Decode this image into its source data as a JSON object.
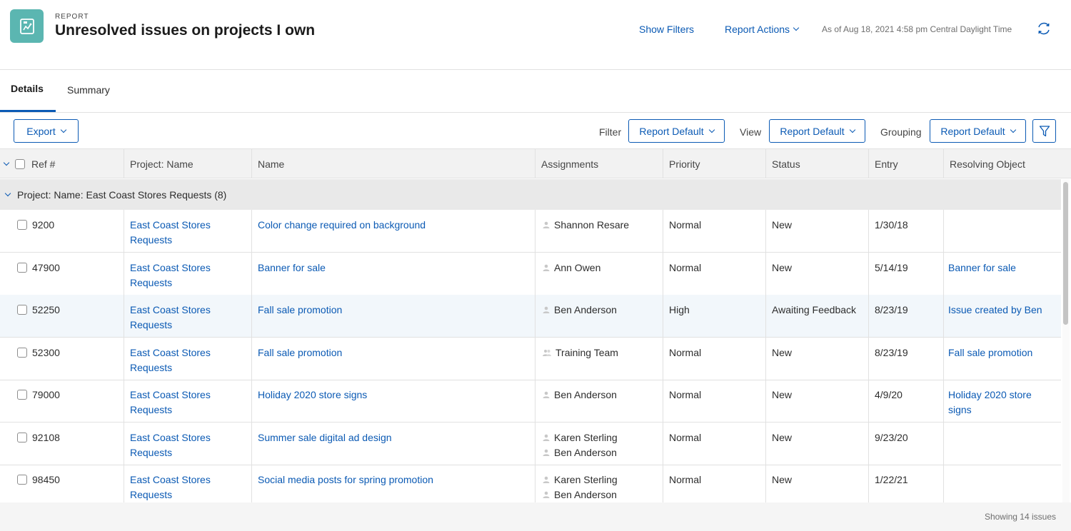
{
  "header": {
    "kicker": "REPORT",
    "title": "Unresolved issues on projects I own",
    "show_filters": "Show Filters",
    "report_actions": "Report Actions",
    "as_of": "As of Aug 18, 2021 4:58 pm Central Daylight Time",
    "icon": "report-chart-icon",
    "accent_color": "#5bb6b1"
  },
  "tabs": [
    {
      "label": "Details",
      "active": true
    },
    {
      "label": "Summary",
      "active": false
    }
  ],
  "toolbar": {
    "export_label": "Export",
    "filter_label": "Filter",
    "filter_value": "Report Default",
    "view_label": "View",
    "view_value": "Report Default",
    "grouping_label": "Grouping",
    "grouping_value": "Report Default"
  },
  "columns": [
    "Ref #",
    "Project: Name",
    "Name",
    "Assignments",
    "Priority",
    "Status",
    "Entry",
    "Resolving Object"
  ],
  "group": {
    "label": "Project: Name: East Coast Stores Requests (8)"
  },
  "rows": [
    {
      "ref": "9200",
      "project_l1": "East Coast Stores",
      "project_l2": "Requests",
      "name": "Color change required on background",
      "assign1": "Shannon Resare",
      "assign2": "",
      "priority": "Normal",
      "status": "New",
      "entry": "1/30/18",
      "res1": "",
      "res2": ""
    },
    {
      "ref": "47900",
      "project_l1": "East Coast Stores",
      "project_l2": "Requests",
      "name": "Banner for sale",
      "assign1": "Ann Owen",
      "assign2": "",
      "priority": "Normal",
      "status": "New",
      "entry": "5/14/19",
      "res1": "Banner for sale",
      "res2": ""
    },
    {
      "ref": "52250",
      "project_l1": "East Coast Stores",
      "project_l2": "Requests",
      "name": "Fall sale promotion",
      "assign1": "Ben Anderson",
      "assign2": "",
      "priority": "High",
      "status": "Awaiting Feedback",
      "entry": "8/23/19",
      "res1": "Issue created by Ben",
      "res2": ""
    },
    {
      "ref": "52300",
      "project_l1": "East Coast Stores",
      "project_l2": "Requests",
      "name": "Fall sale promotion",
      "assign1": "Training Team",
      "assign2": "",
      "priority": "Normal",
      "status": "New",
      "entry": "8/23/19",
      "res1": "Fall sale promotion",
      "res2": ""
    },
    {
      "ref": "79000",
      "project_l1": "East Coast Stores",
      "project_l2": "Requests",
      "name": "Holiday 2020 store signs",
      "assign1": "Ben Anderson",
      "assign2": "",
      "priority": "Normal",
      "status": "New",
      "entry": "4/9/20",
      "res1": "Holiday 2020 store",
      "res2": "signs"
    },
    {
      "ref": "92108",
      "project_l1": "East Coast Stores",
      "project_l2": "Requests",
      "name": "Summer sale digital ad design",
      "assign1": "Karen Sterling",
      "assign2": "Ben Anderson",
      "priority": "Normal",
      "status": "New",
      "entry": "9/23/20",
      "res1": "",
      "res2": ""
    },
    {
      "ref": "98450",
      "project_l1": "East Coast Stores",
      "project_l2": "Requests",
      "name": "Social media posts for spring promotion",
      "assign1": "Karen Sterling",
      "assign2": "Ben Anderson",
      "priority": "Normal",
      "status": "New",
      "entry": "1/22/21",
      "res1": "",
      "res2": ""
    }
  ],
  "footer": {
    "showing": "Showing 14 issues"
  }
}
